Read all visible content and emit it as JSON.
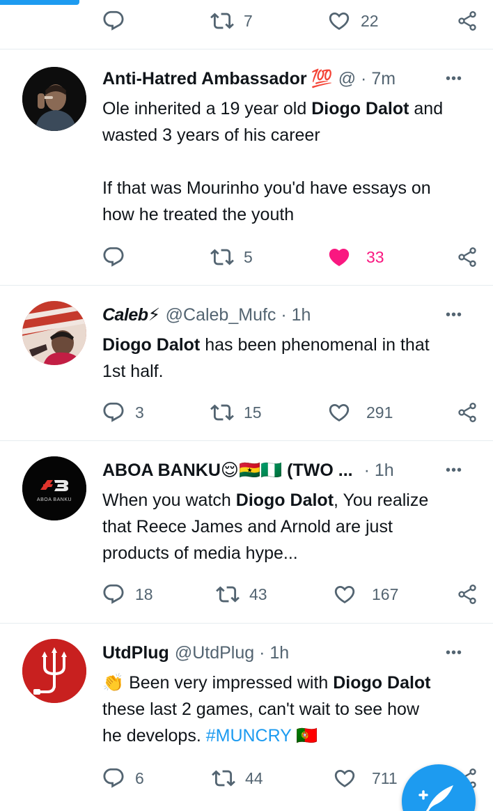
{
  "prev_tweet": {
    "retweets": "7",
    "likes": "22"
  },
  "tweets": [
    {
      "name": "Anti-Hatred Ambassador",
      "name_emoji": "💯",
      "handle": "@ · 7m",
      "lines": [
        [
          "Ole inherited a 19 year old ",
          "Diogo Dalot",
          " and"
        ],
        [
          "wasted 3 years of his career"
        ],
        [
          ""
        ],
        [
          "If that was Mourinho you'd have essays on"
        ],
        [
          "how he treated the youth"
        ]
      ],
      "replies": "",
      "retweets": "5",
      "likes": "33",
      "liked": true
    },
    {
      "name": "Caleb⚡",
      "handle": "@Caleb_Mufc · 1h",
      "lines": [
        [
          "",
          "Diogo Dalot",
          " has been phenomenal in that"
        ],
        [
          "1st half."
        ]
      ],
      "replies": "3",
      "retweets": "15",
      "likes": "291",
      "liked": false
    },
    {
      "name": "ABOA BANKU😌🇬🇭🇳🇬 (TWO ...",
      "handle": "· 1h",
      "avatar_text": "ABOA BANKU",
      "lines": [
        [
          "When you watch ",
          "Diogo Dalot",
          ", You realize"
        ],
        [
          "that Reece James and Arnold are just"
        ],
        [
          "products of media hype..."
        ]
      ],
      "replies": "18",
      "retweets": "43",
      "likes": "167",
      "liked": false
    },
    {
      "name": "UtdPlug",
      "handle": "@UtdPlug · 1h",
      "lines": [
        [
          "👏 Been very impressed with ",
          "Diogo Dalot"
        ],
        [
          "these last 2 games, can't wait to see how"
        ],
        [
          "he develops. ",
          "#MUNCRY",
          " 🇵🇹"
        ]
      ],
      "replies": "6",
      "retweets": "44",
      "likes": "711",
      "liked": false
    }
  ],
  "more_label": "•••",
  "icons": [
    "reply-icon",
    "retweet-icon",
    "like-icon",
    "share-icon",
    "more-icon",
    "compose-icon"
  ],
  "colors": {
    "accent": "#1d9bf0",
    "like": "#f91880",
    "muted": "#536471"
  }
}
